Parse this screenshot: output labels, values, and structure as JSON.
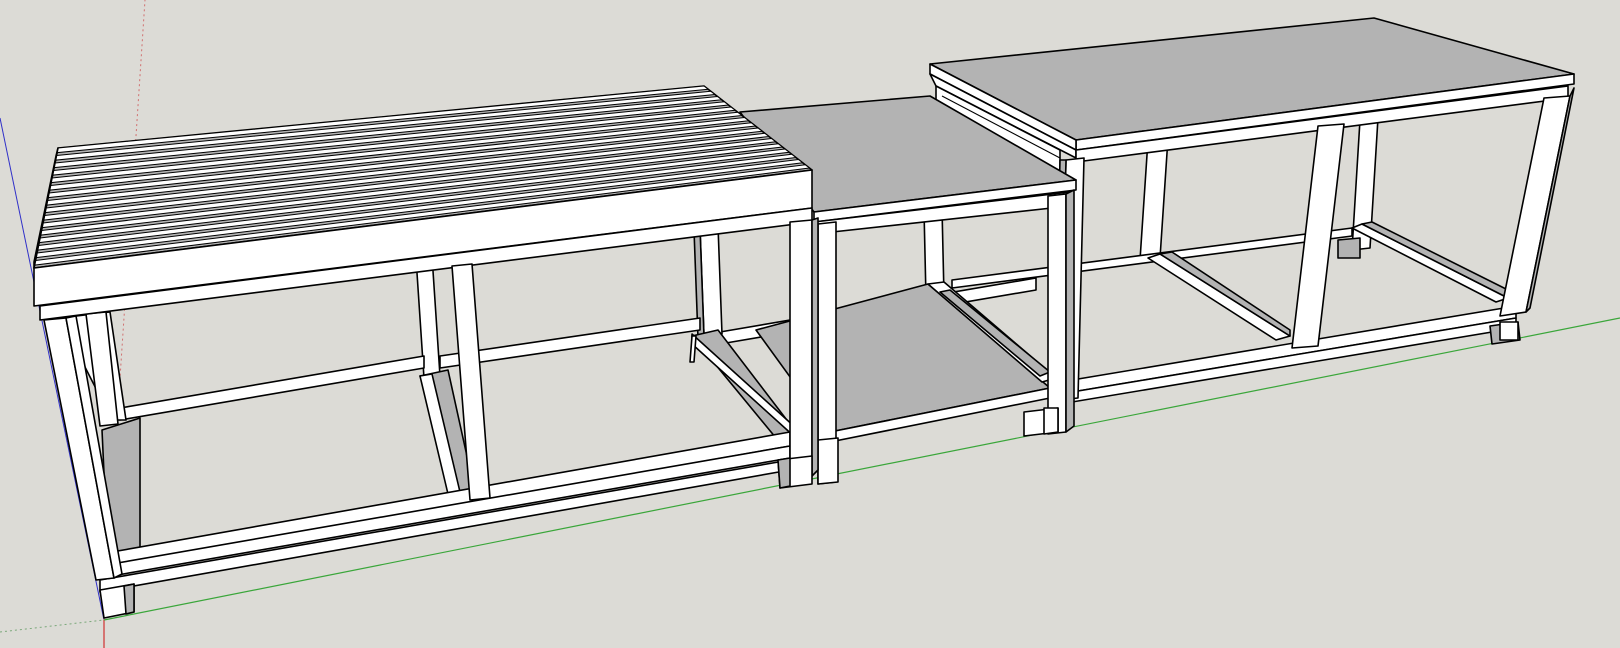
{
  "viewport": {
    "background_color": "#dcdbd6",
    "face_front_color": "#ffffff",
    "face_shaded_color": "#b3b3b3",
    "edge_color": "#000000"
  },
  "axes": {
    "red_axis_color": "#d03030",
    "green_axis_color": "#3aa63a",
    "blue_axis_color": "#3030c8"
  },
  "model": {
    "objects": [
      "slatted-top-bench",
      "middle-shelf-unit",
      "tall-table"
    ],
    "slat_count": 16
  }
}
